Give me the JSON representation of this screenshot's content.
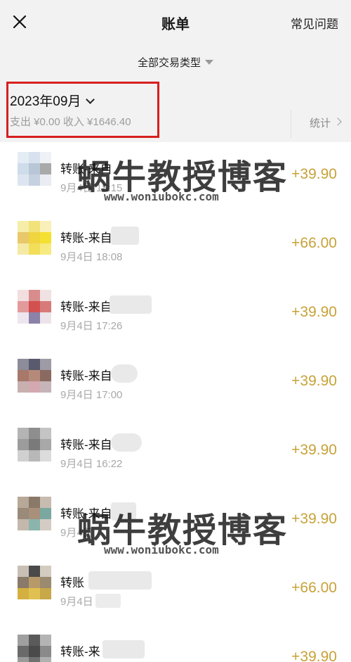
{
  "header": {
    "title": "账单",
    "help_label": "常见问题"
  },
  "filter": {
    "label": "全部交易类型"
  },
  "month": {
    "label": "2023年09月",
    "summary": "支出 ¥0.00 收入 ¥1646.40"
  },
  "stats": {
    "label": "统计"
  },
  "transactions": [
    {
      "name": "转账-来自",
      "time": "9月4日 18:15",
      "amount": "+39.90"
    },
    {
      "name": "转账-来自",
      "time": "9月4日 18:08",
      "amount": "+66.00"
    },
    {
      "name": "转账-来自",
      "time": "9月4日 17:26",
      "amount": "+39.90"
    },
    {
      "name": "转账-来自",
      "time": "9月4日 17:00",
      "amount": "+39.90"
    },
    {
      "name": "转账-来自",
      "time": "9月4日 16:22",
      "amount": "+39.90"
    },
    {
      "name": "转账-来自",
      "time": "9月4日",
      "amount": "+39.90"
    },
    {
      "name": "转账",
      "time": "9月4日",
      "amount": "+66.00"
    },
    {
      "name": "转账-来",
      "time": "",
      "amount": "+39.90"
    }
  ],
  "watermark": {
    "text": "蜗牛教授博客",
    "url": "www.woniubokc.com"
  },
  "colors": {
    "background_header": "#f2f2f2",
    "highlight_border": "#d71f1f",
    "amount": "#c7a238"
  }
}
